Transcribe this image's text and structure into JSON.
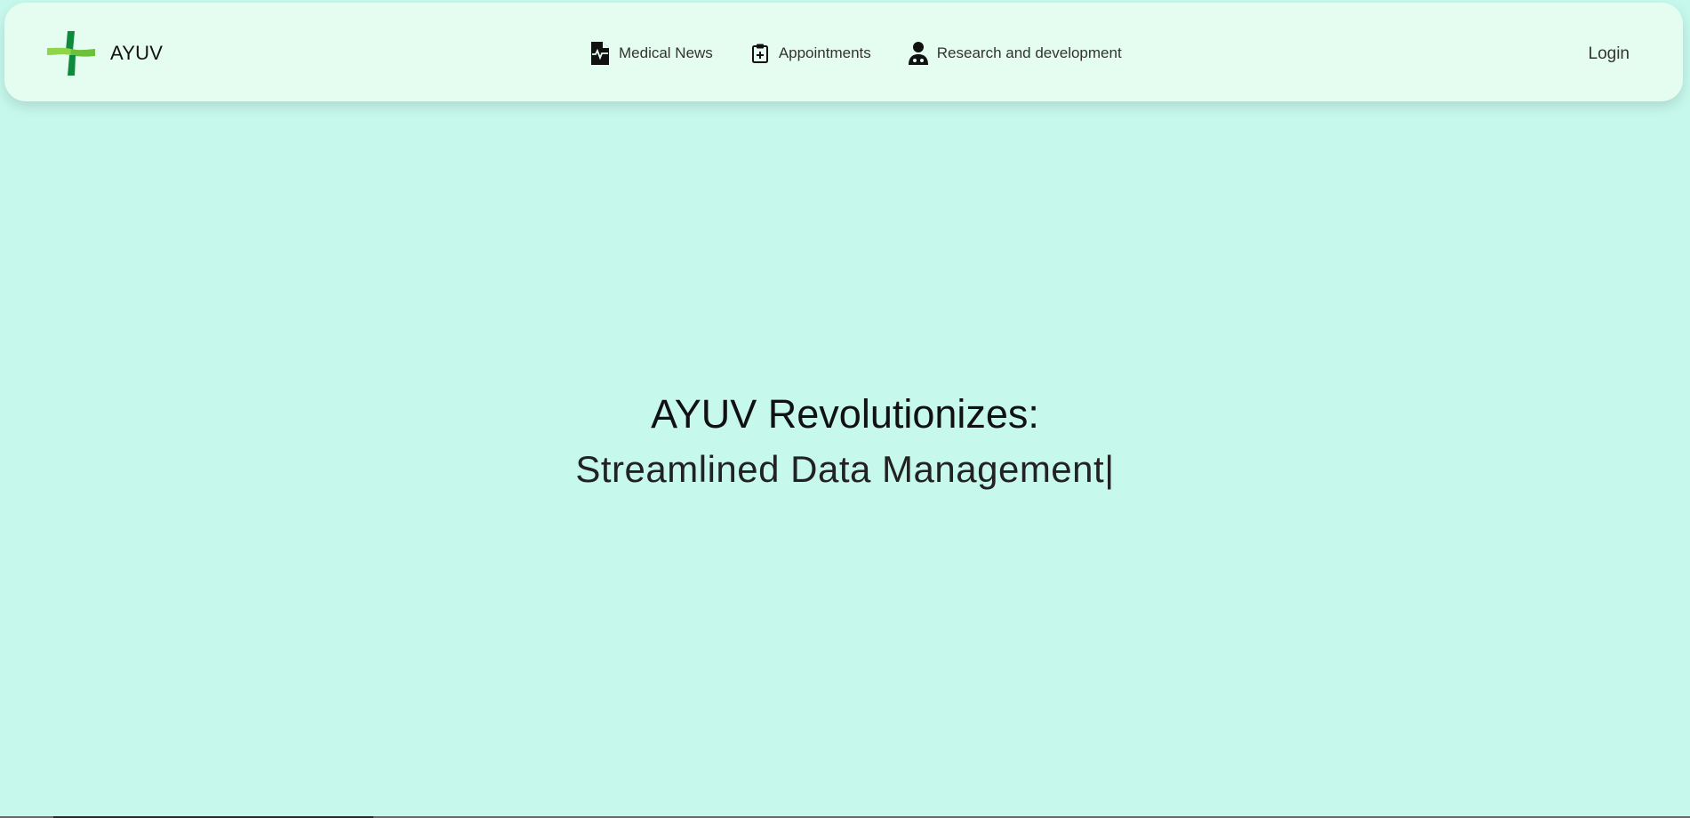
{
  "brand": {
    "name": "AYUV",
    "logo_icon": "green-cross-logo"
  },
  "nav": {
    "items": [
      {
        "label": "Medical News",
        "icon": "medical-file-icon"
      },
      {
        "label": "Appointments",
        "icon": "clipboard-plus-icon"
      },
      {
        "label": "Research and development",
        "icon": "doctor-icon"
      }
    ],
    "login_label": "Login"
  },
  "hero": {
    "title": "AYUV Revolutionizes:",
    "subtitle": "Streamlined Data Management|"
  },
  "colors": {
    "background": "#c6f8ec",
    "navbar": "#e4fdf0",
    "logo_dark_green": "#0e8a3c",
    "logo_light_green": "#8ed54a"
  }
}
